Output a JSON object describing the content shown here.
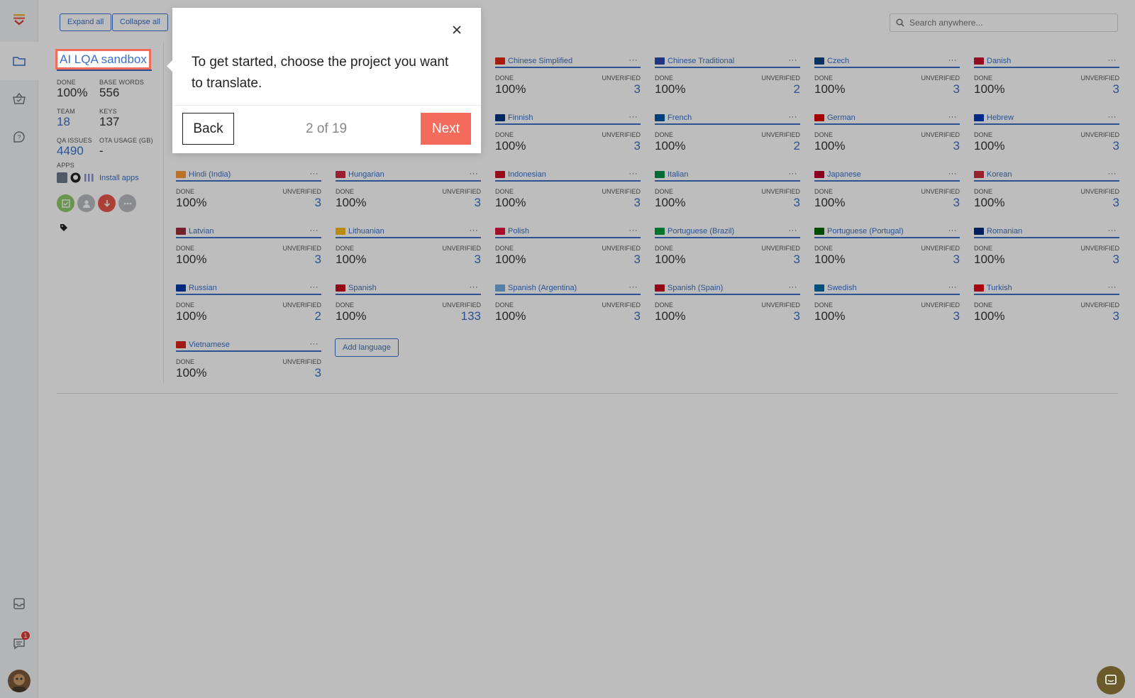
{
  "toolbar": {
    "expand_label": "Expand all",
    "collapse_label": "Collapse all"
  },
  "search": {
    "placeholder": "Search anywhere..."
  },
  "project": {
    "title": "AI LQA sandbox",
    "done_label": "DONE",
    "done_value": "100%",
    "base_words_label": "BASE WORDS",
    "base_words_value": "556",
    "team_label": "TEAM",
    "team_value": "18",
    "keys_label": "KEYS",
    "keys_value": "137",
    "qa_label": "QA ISSUES",
    "qa_value": "4490",
    "ota_label": "OTA USAGE (GB)",
    "ota_value": "-",
    "apps_label": "APPS",
    "install_label": "Install apps"
  },
  "labels": {
    "done": "DONE",
    "unverified": "UNVERIFIED",
    "more": "···"
  },
  "languages": [
    {
      "name": "Chinese Simplified",
      "done": "100%",
      "unverified": "3",
      "flag": "#de2910"
    },
    {
      "name": "Chinese Traditional",
      "done": "100%",
      "unverified": "2",
      "flag": "#2a4bb0"
    },
    {
      "name": "Czech",
      "done": "100%",
      "unverified": "3",
      "flag": "#11457e"
    },
    {
      "name": "Danish",
      "done": "100%",
      "unverified": "3",
      "flag": "#c8102e"
    },
    {
      "name": "Finnish",
      "done": "100%",
      "unverified": "3",
      "flag": "#003580"
    },
    {
      "name": "French",
      "done": "100%",
      "unverified": "2",
      "flag": "#0055a4"
    },
    {
      "name": "German",
      "done": "100%",
      "unverified": "3",
      "flag": "#dd0000"
    },
    {
      "name": "Hebrew",
      "done": "100%",
      "unverified": "3",
      "flag": "#0038b8"
    },
    {
      "name": "Hindi (India)",
      "done": "100%",
      "unverified": "3",
      "flag": "#ff9933"
    },
    {
      "name": "Hungarian",
      "done": "100%",
      "unverified": "3",
      "flag": "#cd2a3e"
    },
    {
      "name": "Indonesian",
      "done": "100%",
      "unverified": "3",
      "flag": "#ce1126"
    },
    {
      "name": "Italian",
      "done": "100%",
      "unverified": "3",
      "flag": "#009246"
    },
    {
      "name": "Japanese",
      "done": "100%",
      "unverified": "3",
      "flag": "#bc002d"
    },
    {
      "name": "Korean",
      "done": "100%",
      "unverified": "3",
      "flag": "#cd2e3a"
    },
    {
      "name": "Latvian",
      "done": "100%",
      "unverified": "3",
      "flag": "#9e3039"
    },
    {
      "name": "Lithuanian",
      "done": "100%",
      "unverified": "3",
      "flag": "#fdb913"
    },
    {
      "name": "Polish",
      "done": "100%",
      "unverified": "3",
      "flag": "#dc143c"
    },
    {
      "name": "Portuguese (Brazil)",
      "done": "100%",
      "unverified": "3",
      "flag": "#009c3b"
    },
    {
      "name": "Portuguese (Portugal)",
      "done": "100%",
      "unverified": "3",
      "flag": "#006600"
    },
    {
      "name": "Romanian",
      "done": "100%",
      "unverified": "3",
      "flag": "#002b7f"
    },
    {
      "name": "Russian",
      "done": "100%",
      "unverified": "2",
      "flag": "#0039a6"
    },
    {
      "name": "Spanish",
      "done": "100%",
      "unverified": "133",
      "flag": "#c60b1e"
    },
    {
      "name": "Spanish (Argentina)",
      "done": "100%",
      "unverified": "3",
      "flag": "#74acdf"
    },
    {
      "name": "Spanish (Spain)",
      "done": "100%",
      "unverified": "3",
      "flag": "#c60b1e"
    },
    {
      "name": "Swedish",
      "done": "100%",
      "unverified": "3",
      "flag": "#006aa7"
    },
    {
      "name": "Turkish",
      "done": "100%",
      "unverified": "3",
      "flag": "#e30a17"
    },
    {
      "name": "Vietnamese",
      "done": "100%",
      "unverified": "3",
      "flag": "#da251d"
    }
  ],
  "add_language_label": "Add language",
  "tour": {
    "text": "To get started, choose the project you want to translate.",
    "back_label": "Back",
    "progress": "2 of 19",
    "next_label": "Next"
  },
  "notifications": {
    "count": "1"
  },
  "colors": {
    "accent": "#3b6fc4",
    "highlight": "#f26b5b",
    "logo": "#f2b33d"
  }
}
